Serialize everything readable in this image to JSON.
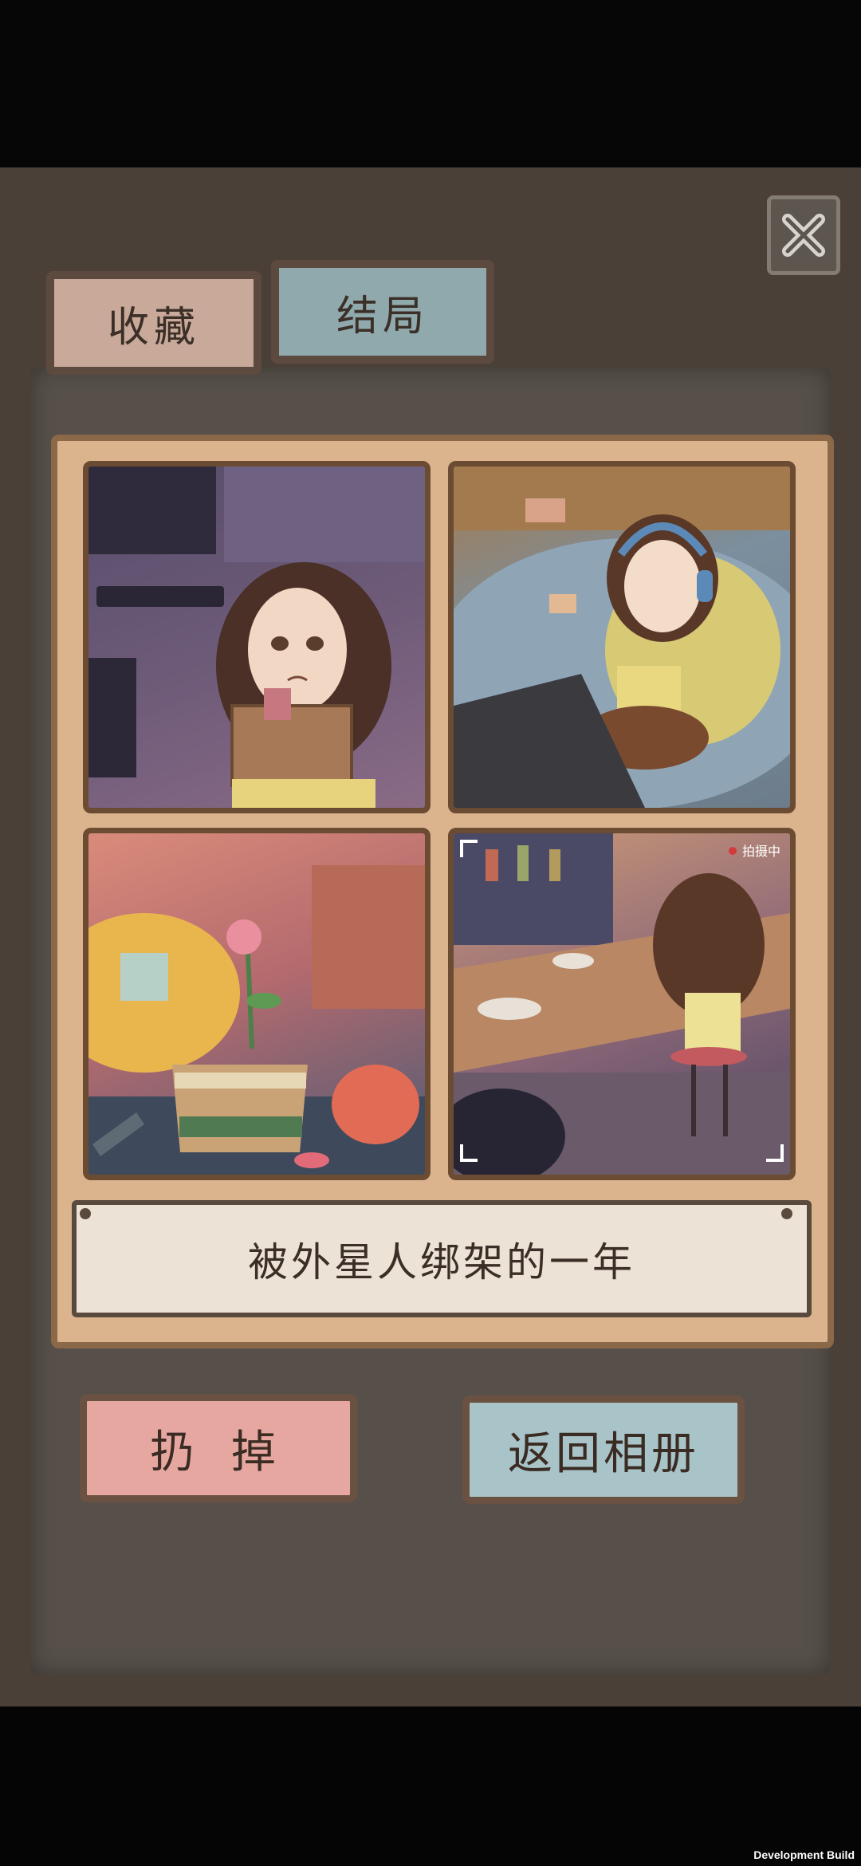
{
  "tabs": {
    "collect": "收藏",
    "ending": "结局"
  },
  "close_icon": "close-x-icon",
  "photo_overlay": {
    "recording_badge": "拍摄中"
  },
  "caption": "被外星人绑架的一年",
  "buttons": {
    "discard": "扔 掉",
    "back_to_album": "返回相册"
  },
  "footer": {
    "dev_build": "Development Build"
  },
  "colors": {
    "tab_active": "#8fa9ad",
    "tab_inactive": "#c8a99a",
    "discard": "#e6a7a1",
    "album": "#a9c4c8"
  }
}
